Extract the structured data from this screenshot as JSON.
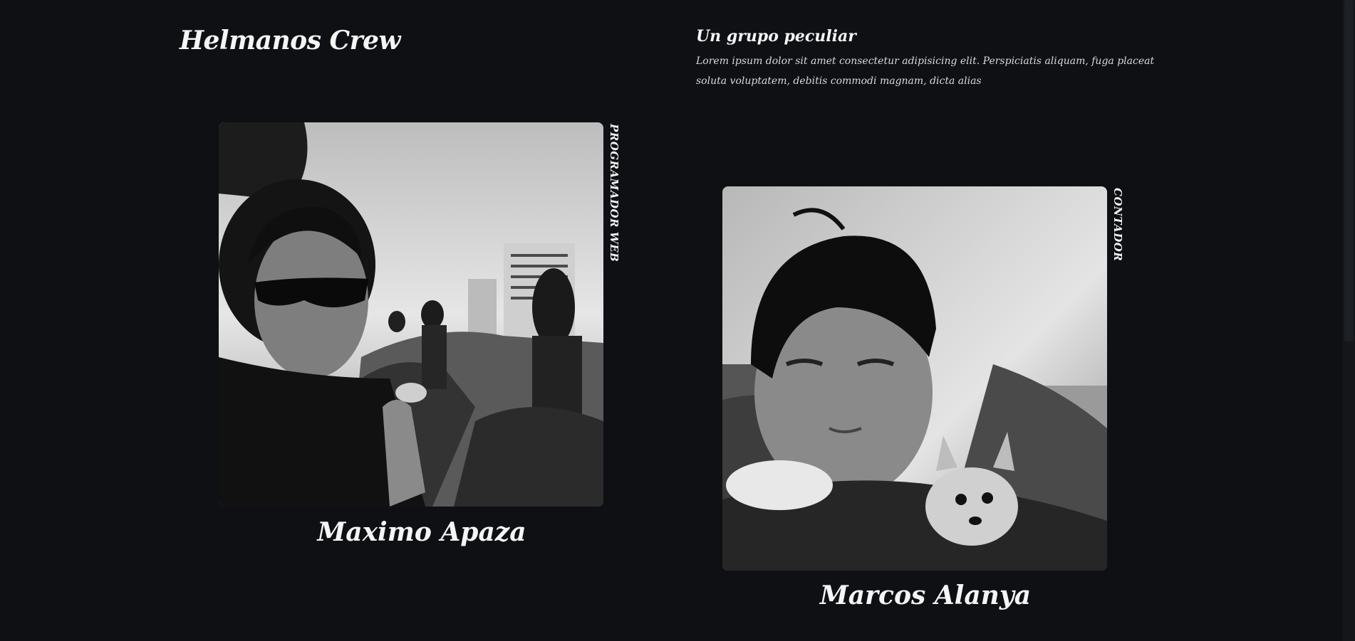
{
  "header": {
    "brand": "Helmanos Crew"
  },
  "intro": {
    "title": "Un grupo peculiar",
    "text": "Lorem ipsum dolor sit amet consectetur adipisicing elit. Perspiciatis aliquam, fuga placeat soluta voluptatem, debitis commodi magnam, dicta alias"
  },
  "members": [
    {
      "name": "Maximo Apaza",
      "role": "PROGRAMADOR WEB"
    },
    {
      "name": "Marcos Alanya",
      "role": "CONTADOR"
    }
  ],
  "colors": {
    "background": "#0e1013",
    "text": "#f5f5f5"
  }
}
